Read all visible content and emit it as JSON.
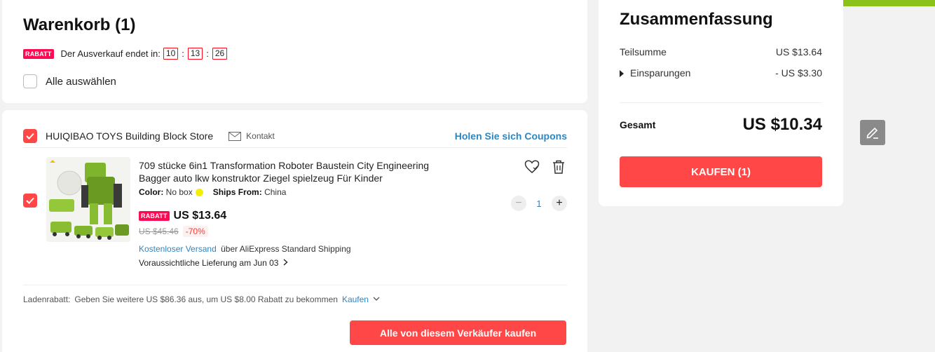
{
  "cart": {
    "title": "Warenkorb (1)",
    "sale_badge": "RABATT",
    "sale_text": "Der Ausverkauf endet in:",
    "timer": {
      "hours": "10",
      "minutes": "13",
      "seconds": "26"
    },
    "select_all_label": "Alle auswählen"
  },
  "store": {
    "name": "HUIQIBAO TOYS Building Block Store",
    "contact_label": "Kontakt",
    "coupons_label": "Holen Sie sich Coupons",
    "item": {
      "title": "709 stücke 6in1 Transformation Roboter Baustein City Engineering Bagger auto lkw konstruktor Ziegel spielzeug Für Kinder",
      "color_label": "Color:",
      "color_value": "No box",
      "ships_from_label": "Ships From:",
      "ships_from_value": "China",
      "price_badge": "RABATT",
      "price": "US $13.64",
      "original_price": "US $45.46",
      "discount": "-70%",
      "free_shipping": "Kostenloser Versand",
      "shipping_method": "über AliExpress Standard Shipping",
      "delivery": "Voraussichtliche Lieferung am Jun 03",
      "quantity": "1"
    },
    "store_discount": {
      "label": "Ladenrabatt:",
      "text": "Geben Sie weitere US $86.36 aus, um US $8.00 Rabatt zu bekommen",
      "link": "Kaufen"
    },
    "buy_all_label": "Alle von diesem Verkäufer kaufen"
  },
  "summary": {
    "title": "Zusammenfassung",
    "subtotal_label": "Teilsumme",
    "subtotal_value": "US $13.64",
    "savings_label": "Einsparungen",
    "savings_value": "- US $3.30",
    "total_label": "Gesamt",
    "total_value": "US $10.34",
    "checkout_label": "KAUFEN (1)"
  },
  "colors": {
    "accent_red": "#ff4747",
    "badge_pink": "#ff0b54",
    "link_blue": "#2e86c1",
    "top_bar_green": "#8ac21a"
  }
}
